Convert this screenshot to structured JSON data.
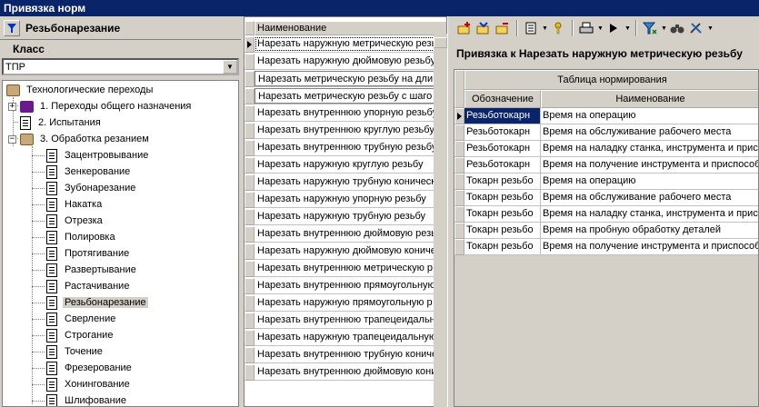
{
  "window": {
    "title": "Привязка норм"
  },
  "left": {
    "header_title": "Резьбонарезание",
    "class_label": "Класс",
    "class_value": "ТПР",
    "tree": {
      "root": "Технологические переходы",
      "groups": [
        {
          "label": "1. Переходы общего назначения"
        },
        {
          "label": "2. Испытания"
        },
        {
          "label": "3. Обработка резанием"
        }
      ],
      "children": [
        "Зацентровывание",
        "Зенкерование",
        "Зубонарезание",
        "Накатка",
        "Отрезка",
        "Полировка",
        "Протягивание",
        "Развертывание",
        "Растачивание",
        "Резьбонарезание",
        "Сверление",
        "Строгание",
        "Точение",
        "Фрезерование",
        "Хонингование",
        "Шлифование"
      ],
      "selected_child": "Резьбонарезание"
    }
  },
  "middle": {
    "column_header": "Наименование",
    "rows": [
      "Нарезать наружную метрическую резь",
      "Нарезать наружную дюймовую резьбу",
      "Нарезать метрическую резьбу на дли",
      "Нарезать метрическую резьбу с шаго",
      "Нарезать внутреннюю упорную резьбу",
      "Нарезать внутреннюю круглую резьбу",
      "Нарезать внутреннюю трубную резьбу",
      "Нарезать наружную круглую резьбу",
      "Нарезать наружную трубную коническ",
      "Нарезать наружную упорную резьбу",
      "Нарезать наружную трубную резьбу",
      "Нарезать внутреннюю дюймовую резь",
      "Нарезать наружную дюймовую кониче",
      "Нарезать внутреннюю метрическую р",
      "Нарезать внутреннюю прямоугольную",
      "Нарезать наружную прямоугольную р",
      "Нарезать внутреннюю трапецеидальн",
      "Нарезать наружную трапецеидальную",
      "Нарезать внутреннюю трубную кониче",
      "Нарезать внутреннюю дюймовую кони"
    ]
  },
  "right": {
    "title": "Привязка к Нарезать наружную метрическую резьбу",
    "table_title": "Таблица нормирования",
    "columns": [
      "Обозначение",
      "Наименование"
    ],
    "rows": [
      {
        "code": "Резьботокарн",
        "name": "Время на операцию"
      },
      {
        "code": "Резьботокарн",
        "name": "Время на обслуживание рабочего места"
      },
      {
        "code": "Резьботокарн",
        "name": "Время на наладку станка, инструмента и присп"
      },
      {
        "code": "Резьботокарн",
        "name": "Время на получение инструмента и приспособл"
      },
      {
        "code": "Токарн резьбо",
        "name": "Время на операцию"
      },
      {
        "code": "Токарн резьбо",
        "name": "Время на обслуживание рабочего места"
      },
      {
        "code": "Токарн резьбо",
        "name": "Время на наладку станка, инструмента и присп"
      },
      {
        "code": "Токарн резьбо",
        "name": "Время на пробную обработку деталей"
      },
      {
        "code": "Токарн резьбо",
        "name": "Время на получение инструмента и приспособл"
      }
    ]
  },
  "toolbar": {
    "icons": [
      "add-row-icon",
      "insert-row-icon",
      "delete-row-icon",
      "document-icon",
      "key-icon",
      "print-icon",
      "run-icon",
      "filter-icon",
      "find-icon",
      "tools-icon"
    ]
  },
  "colors": {
    "titlebar": "#0a246a",
    "face": "#d4d0c8",
    "selection": "#0a246a"
  }
}
